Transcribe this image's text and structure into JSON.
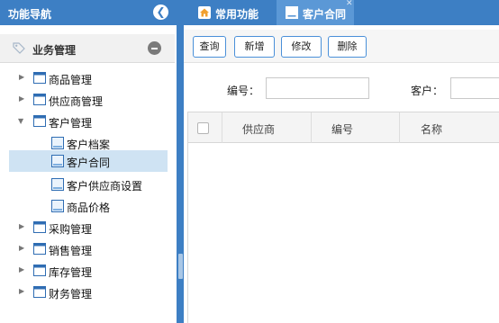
{
  "nav": {
    "title": "功能导航",
    "collapse_icon": "chevron-left-icon",
    "section": {
      "title": "业务管理"
    },
    "items": [
      {
        "label": "商品管理",
        "type": "folder"
      },
      {
        "label": "供应商管理",
        "type": "folder"
      },
      {
        "label": "客户管理",
        "type": "folder",
        "expanded": true
      },
      {
        "label": "客户档案",
        "type": "page"
      },
      {
        "label": "客户合同",
        "type": "page",
        "selected": true
      },
      {
        "label": "客户供应商设置",
        "type": "page"
      },
      {
        "label": "商品价格",
        "type": "page"
      },
      {
        "label": "采购管理",
        "type": "folder"
      },
      {
        "label": "销售管理",
        "type": "folder"
      },
      {
        "label": "库存管理",
        "type": "folder"
      },
      {
        "label": "财务管理",
        "type": "folder"
      }
    ]
  },
  "tabs": [
    {
      "label": "常用功能",
      "icon": "home-icon"
    },
    {
      "label": "客户合同",
      "icon": "document-icon",
      "active": true
    }
  ],
  "toolbar": {
    "query": "查询",
    "add": "新增",
    "edit": "修改",
    "delete": "删除"
  },
  "search": {
    "code_label": "编号：",
    "code_value": "",
    "customer_label": "客户：",
    "customer_value": ""
  },
  "grid": {
    "columns": [
      "供应商",
      "编号",
      "名称"
    ],
    "rows": []
  },
  "colors": {
    "accent": "#3d7fc4",
    "active_tab": "#5b98d6",
    "selected_row": "#cfe3f3"
  }
}
